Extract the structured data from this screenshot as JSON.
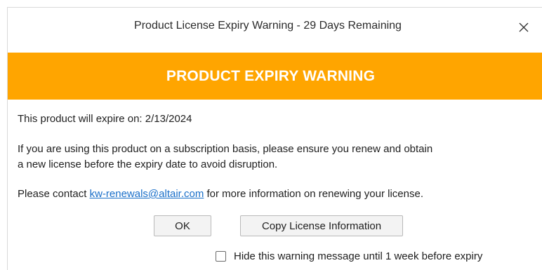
{
  "window": {
    "title": "Product License Expiry Warning - 29 Days Remaining",
    "close_icon": "close-icon"
  },
  "banner": {
    "text": "PRODUCT EXPIRY WARNING",
    "color": "#ffa500"
  },
  "message": {
    "expiry_prefix": "This product will expire on: ",
    "expiry_date": "2/13/2024",
    "subscription_line1": "If you are using this product on a subscription basis, please ensure you renew and obtain",
    "subscription_line2": "a new license before the expiry date to avoid disruption.",
    "contact_prefix": "Please contact ",
    "contact_email": "kw-renewals@altair.com",
    "contact_suffix": " for more information on renewing your license."
  },
  "buttons": {
    "ok_label": "OK",
    "copy_label": "Copy License Information"
  },
  "hide_option": {
    "label": "Hide this warning message until 1 week before expiry",
    "checked": false
  },
  "colors": {
    "accent": "#ffa500",
    "link": "#1a6fc9"
  }
}
